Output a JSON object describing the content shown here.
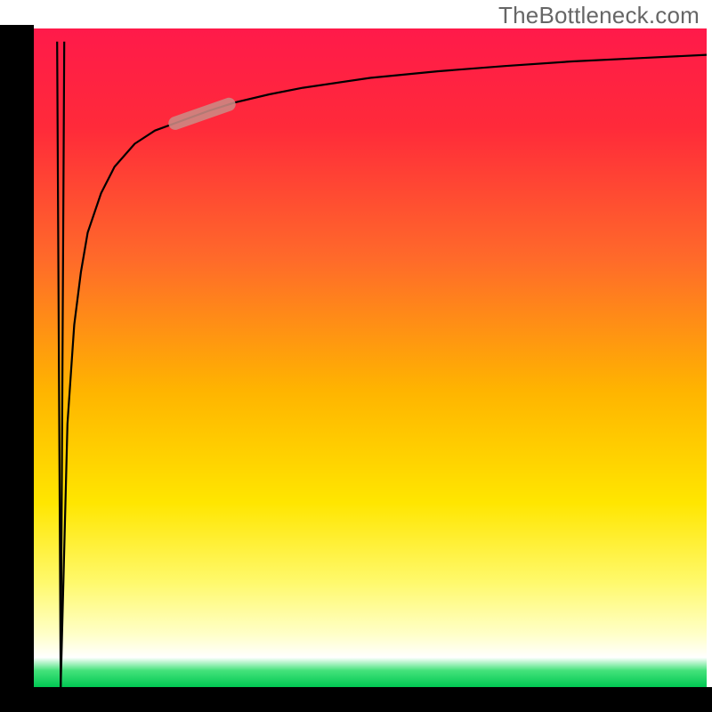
{
  "watermark": "TheBottleneck.com",
  "chart_data": {
    "type": "line",
    "title": "",
    "xlabel": "",
    "ylabel": "",
    "xlim": [
      0,
      100
    ],
    "ylim": [
      0,
      100
    ],
    "grid": false,
    "legend": false,
    "annotations": [],
    "background_gradient": {
      "stops": [
        {
          "offset": 0.0,
          "color": "#ff1a4a"
        },
        {
          "offset": 0.15,
          "color": "#ff2a3a"
        },
        {
          "offset": 0.35,
          "color": "#ff6a2a"
        },
        {
          "offset": 0.55,
          "color": "#ffb400"
        },
        {
          "offset": 0.72,
          "color": "#ffe600"
        },
        {
          "offset": 0.84,
          "color": "#fff96b"
        },
        {
          "offset": 0.92,
          "color": "#ffffc8"
        },
        {
          "offset": 0.955,
          "color": "#ffffff"
        },
        {
          "offset": 0.975,
          "color": "#44e27a"
        },
        {
          "offset": 1.0,
          "color": "#00c853"
        }
      ]
    },
    "highlight_segment": {
      "x_range": [
        21,
        29
      ],
      "y_range": [
        84,
        89
      ],
      "color": "#cc8a84"
    },
    "series": [
      {
        "name": "spike",
        "x": [
          4.0,
          4.0
        ],
        "y": [
          0.0,
          98.0
        ],
        "note": "very narrow spike from baseline up near top at far left"
      },
      {
        "name": "curve",
        "x": [
          4.0,
          5.0,
          6.0,
          7.0,
          8.0,
          10.0,
          12.0,
          15.0,
          18.0,
          22.0,
          26.0,
          30.0,
          35.0,
          40.0,
          50.0,
          60.0,
          70.0,
          80.0,
          90.0,
          100.0
        ],
        "y": [
          0.0,
          40.0,
          55.0,
          63.0,
          69.0,
          75.0,
          79.0,
          82.5,
          84.5,
          86.0,
          87.5,
          88.8,
          90.0,
          91.0,
          92.5,
          93.5,
          94.3,
          95.0,
          95.5,
          96.0
        ],
        "note": "steep log-like rise then plateau near top"
      }
    ]
  }
}
